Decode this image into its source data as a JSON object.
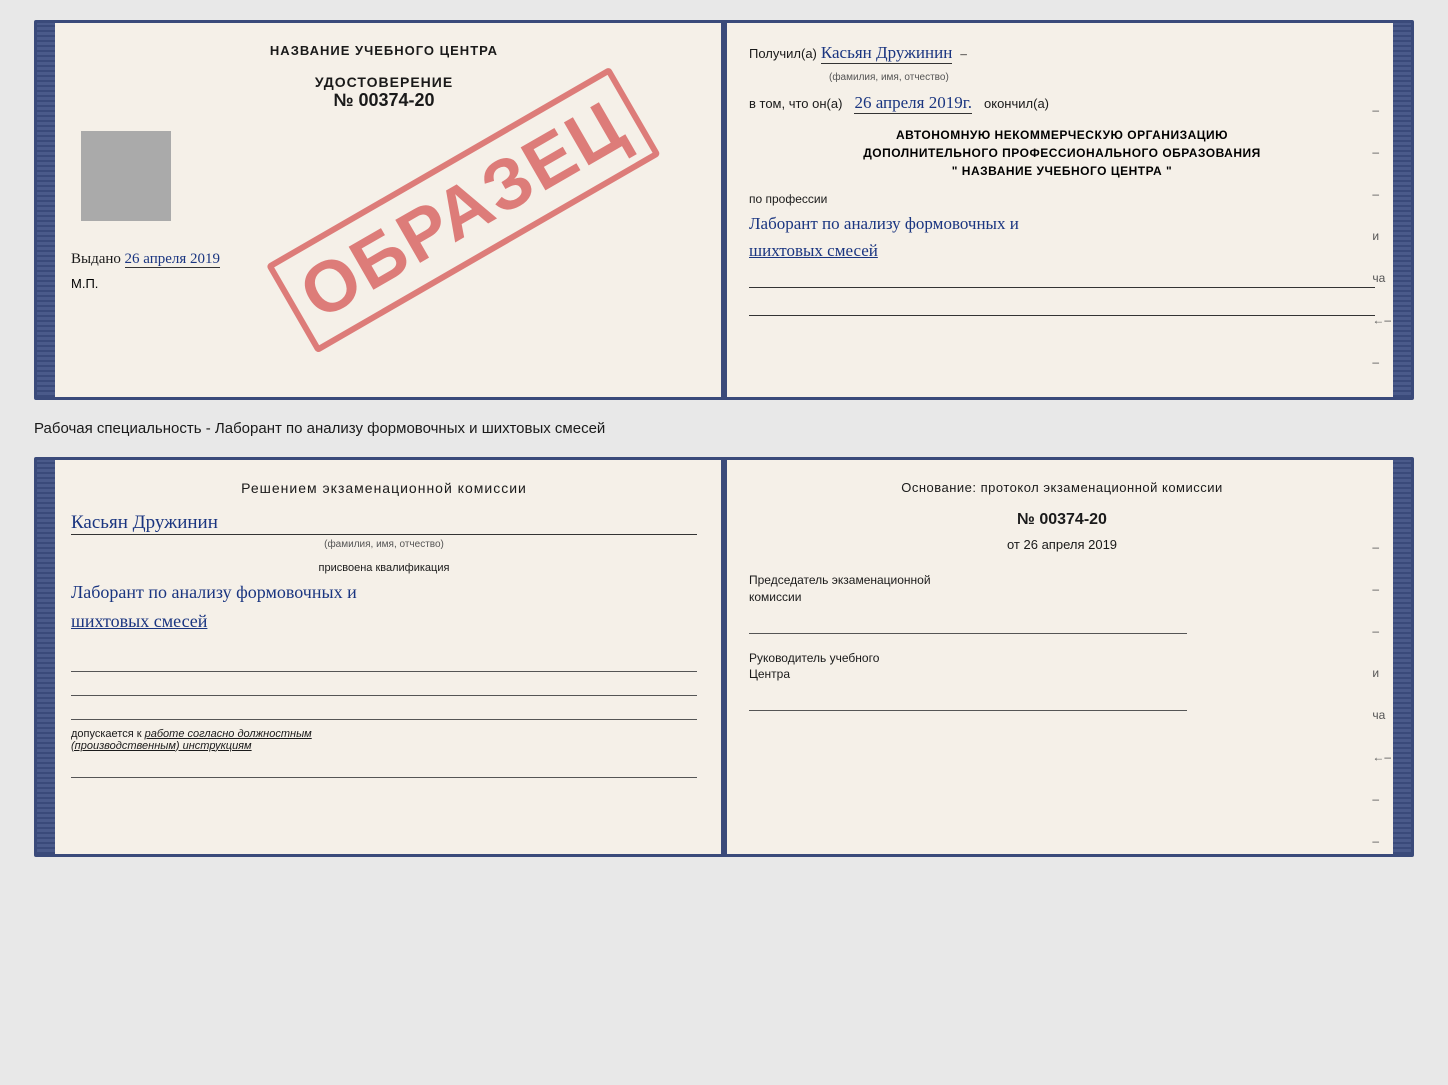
{
  "top_book": {
    "left": {
      "title": "НАЗВАНИЕ УЧЕБНОГО ЦЕНТРА",
      "cert_label": "УДОСТОВЕРЕНИЕ",
      "cert_number_prefix": "№",
      "cert_number": "00374-20",
      "issued_label": "Выдано",
      "issued_date": "26 апреля 2019",
      "mp_label": "М.П.",
      "obrazec": "ОБРАЗЕЦ"
    },
    "right": {
      "received_label": "Получил(а)",
      "received_name": "Касьян Дружинин",
      "name_sublabel": "(фамилия, имя, отчество)",
      "dash1": "–",
      "in_that_label": "в том, что он(а)",
      "date_value": "26 апреля 2019г.",
      "finished_label": "окончил(а)",
      "org_line1": "АВТОНОМНУЮ НЕКОММЕРЧЕСКУЮ ОРГАНИЗАЦИЮ",
      "org_line2": "ДОПОЛНИТЕЛЬНОГО ПРОФЕССИОНАЛЬНОГО ОБРАЗОВАНИЯ",
      "org_line3": "\"  НАЗВАНИЕ УЧЕБНОГО ЦЕНТРА  \"",
      "profession_label": "по профессии",
      "profession_handwritten": "Лаборант по анализу формовочных и\nшихтовых смесей",
      "side_marks": [
        "–",
        "–",
        "–",
        "и",
        "ча",
        "–"
      ]
    }
  },
  "specialty_text": "Рабочая специальность - Лаборант по анализу формовочных и шихтовых смесей",
  "bottom_book": {
    "left": {
      "section_title": "Решением  экзаменационной  комиссии",
      "name_handwritten": "Касьян  Дружинин",
      "name_sublabel": "(фамилия, имя, отчество)",
      "qualification_label": "присвоена квалификация",
      "qualification_handwritten": "Лаборант по анализу формовочных и\nшихтовых смесей",
      "допускается_label": "допускается к",
      "допускается_text": "работе согласно должностным\n(производственным) инструкциям"
    },
    "right": {
      "title": "Основание: протокол экзаменационной  комиссии",
      "number_prefix": "№",
      "number": "00374-20",
      "date_prefix": "от",
      "date_value": "26 апреля 2019",
      "chairman_label": "Председатель экзаменационной\nкомиссии",
      "director_label": "Руководитель учебного\nЦентра",
      "side_marks": [
        "–",
        "–",
        "–",
        "и",
        "ча",
        "–",
        "–",
        "–"
      ]
    }
  }
}
